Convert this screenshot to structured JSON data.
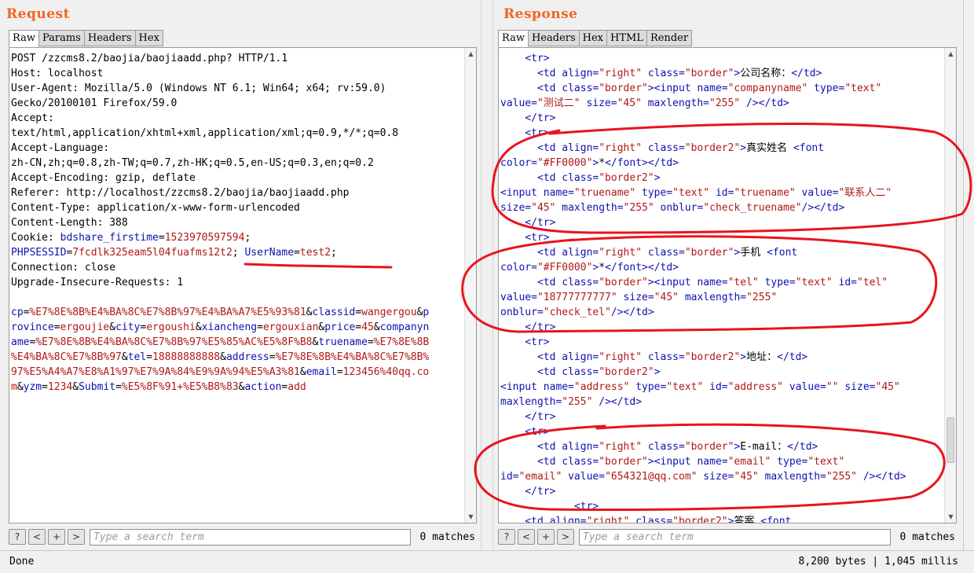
{
  "request": {
    "title": "Request",
    "tabs": [
      "Raw",
      "Params",
      "Headers",
      "Hex"
    ],
    "active_tab": "Raw",
    "lines": [
      [
        {
          "t": "POST /zzcms8.2/baojia/baojiaadd.php? HTTP/1.1",
          "c": "txt"
        }
      ],
      [
        {
          "t": "Host: localhost",
          "c": "txt"
        }
      ],
      [
        {
          "t": "User-Agent: Mozilla/5.0 (Windows NT 6.1; Win64; x64; rv:59.0)",
          "c": "txt"
        }
      ],
      [
        {
          "t": "Gecko/20100101 Firefox/59.0",
          "c": "txt"
        }
      ],
      [
        {
          "t": "Accept:",
          "c": "txt"
        }
      ],
      [
        {
          "t": "text/html,application/xhtml+xml,application/xml;q=0.9,*/*;q=0.8",
          "c": "txt"
        }
      ],
      [
        {
          "t": "Accept-Language:",
          "c": "txt"
        }
      ],
      [
        {
          "t": "zh-CN,zh;q=0.8,zh-TW;q=0.7,zh-HK;q=0.5,en-US;q=0.3,en;q=0.2",
          "c": "txt"
        }
      ],
      [
        {
          "t": "Accept-Encoding: gzip, deflate",
          "c": "txt"
        }
      ],
      [
        {
          "t": "Referer: http://localhost/zzcms8.2/baojia/baojiaadd.php",
          "c": "txt"
        }
      ],
      [
        {
          "t": "Content-Type: application/x-www-form-urlencoded",
          "c": "txt"
        }
      ],
      [
        {
          "t": "Content-Length: 388",
          "c": "txt"
        }
      ],
      [
        {
          "t": "Cookie: ",
          "c": "txt"
        },
        {
          "t": "bdshare_firstime",
          "c": "k"
        },
        {
          "t": "=",
          "c": "txt"
        },
        {
          "t": "1523970597594",
          "c": "v"
        },
        {
          "t": ";",
          "c": "txt"
        }
      ],
      [
        {
          "t": "PHPSESSID",
          "c": "k"
        },
        {
          "t": "=",
          "c": "txt"
        },
        {
          "t": "7fcdlk325eam5l04fuafms12t2",
          "c": "v"
        },
        {
          "t": "; ",
          "c": "txt"
        },
        {
          "t": "UserName",
          "c": "k"
        },
        {
          "t": "=",
          "c": "txt"
        },
        {
          "t": "test2",
          "c": "v"
        },
        {
          "t": ";",
          "c": "txt"
        }
      ],
      [
        {
          "t": "Connection: close",
          "c": "txt"
        }
      ],
      [
        {
          "t": "Upgrade-Insecure-Requests: 1",
          "c": "txt"
        }
      ],
      [
        {
          "t": "",
          "c": "txt"
        }
      ],
      [
        {
          "t": "cp",
          "c": "k"
        },
        {
          "t": "=",
          "c": "txt"
        },
        {
          "t": "%E7%8E%8B%E4%BA%8C%E7%8B%97%E4%BA%A7%E5%93%81",
          "c": "v"
        },
        {
          "t": "&",
          "c": "txt"
        },
        {
          "t": "classid",
          "c": "k"
        },
        {
          "t": "=",
          "c": "txt"
        },
        {
          "t": "wangergou",
          "c": "v"
        },
        {
          "t": "&",
          "c": "txt"
        },
        {
          "t": "p",
          "c": "k"
        }
      ],
      [
        {
          "t": "rovince",
          "c": "k"
        },
        {
          "t": "=",
          "c": "txt"
        },
        {
          "t": "ergoujie",
          "c": "v"
        },
        {
          "t": "&",
          "c": "txt"
        },
        {
          "t": "city",
          "c": "k"
        },
        {
          "t": "=",
          "c": "txt"
        },
        {
          "t": "ergoushi",
          "c": "v"
        },
        {
          "t": "&",
          "c": "txt"
        },
        {
          "t": "xiancheng",
          "c": "k"
        },
        {
          "t": "=",
          "c": "txt"
        },
        {
          "t": "ergouxian",
          "c": "v"
        },
        {
          "t": "&",
          "c": "txt"
        },
        {
          "t": "price",
          "c": "k"
        },
        {
          "t": "=",
          "c": "txt"
        },
        {
          "t": "45",
          "c": "v"
        },
        {
          "t": "&",
          "c": "txt"
        },
        {
          "t": "companyn",
          "c": "k"
        }
      ],
      [
        {
          "t": "ame",
          "c": "k"
        },
        {
          "t": "=",
          "c": "txt"
        },
        {
          "t": "%E7%8E%8B%E4%BA%8C%E7%8B%97%E5%85%AC%E5%8F%B8",
          "c": "v"
        },
        {
          "t": "&",
          "c": "txt"
        },
        {
          "t": "truename",
          "c": "k"
        },
        {
          "t": "=",
          "c": "txt"
        },
        {
          "t": "%E7%8E%8B",
          "c": "v"
        }
      ],
      [
        {
          "t": "%E4%BA%8C%E7%8B%97",
          "c": "v"
        },
        {
          "t": "&",
          "c": "txt"
        },
        {
          "t": "tel",
          "c": "k"
        },
        {
          "t": "=",
          "c": "txt"
        },
        {
          "t": "18888888888",
          "c": "v"
        },
        {
          "t": "&",
          "c": "txt"
        },
        {
          "t": "address",
          "c": "k"
        },
        {
          "t": "=",
          "c": "txt"
        },
        {
          "t": "%E7%8E%8B%E4%BA%8C%E7%8B%",
          "c": "v"
        }
      ],
      [
        {
          "t": "97%E5%A4%A7%E8%A1%97%E7%9A%84%E9%9A%94%E5%A3%81",
          "c": "v"
        },
        {
          "t": "&",
          "c": "txt"
        },
        {
          "t": "email",
          "c": "k"
        },
        {
          "t": "=",
          "c": "txt"
        },
        {
          "t": "123456%40qq.co",
          "c": "v"
        }
      ],
      [
        {
          "t": "m",
          "c": "v"
        },
        {
          "t": "&",
          "c": "txt"
        },
        {
          "t": "yzm",
          "c": "k"
        },
        {
          "t": "=",
          "c": "txt"
        },
        {
          "t": "1234",
          "c": "v"
        },
        {
          "t": "&",
          "c": "txt"
        },
        {
          "t": "Submit",
          "c": "k"
        },
        {
          "t": "=",
          "c": "txt"
        },
        {
          "t": "%E5%8F%91+%E5%B8%83",
          "c": "v"
        },
        {
          "t": "&",
          "c": "txt"
        },
        {
          "t": "action",
          "c": "k"
        },
        {
          "t": "=",
          "c": "txt"
        },
        {
          "t": "add",
          "c": "v"
        }
      ]
    ],
    "search_placeholder": "Type a search term",
    "matches": "0 matches"
  },
  "response": {
    "title": "Response",
    "tabs": [
      "Raw",
      "Headers",
      "Hex",
      "HTML",
      "Render"
    ],
    "active_tab": "Raw",
    "lines": [
      [
        {
          "t": "    <tr>",
          "c": "tag"
        }
      ],
      [
        {
          "t": "      <td align=",
          "c": "tag"
        },
        {
          "t": "\"right\"",
          "c": "str"
        },
        {
          "t": " class=",
          "c": "tag"
        },
        {
          "t": "\"border\"",
          "c": "str"
        },
        {
          "t": ">",
          "c": "tag"
        },
        {
          "t": "公司名称：",
          "c": "txt"
        },
        {
          "t": "</td>",
          "c": "tag"
        }
      ],
      [
        {
          "t": "      <td class=",
          "c": "tag"
        },
        {
          "t": "\"border\"",
          "c": "str"
        },
        {
          "t": "><input name=",
          "c": "tag"
        },
        {
          "t": "\"companyname\"",
          "c": "str"
        },
        {
          "t": " type=",
          "c": "tag"
        },
        {
          "t": "\"text\"",
          "c": "str"
        }
      ],
      [
        {
          "t": "value=",
          "c": "tag"
        },
        {
          "t": "\"测试二\"",
          "c": "str"
        },
        {
          "t": " size=",
          "c": "tag"
        },
        {
          "t": "\"45\"",
          "c": "str"
        },
        {
          "t": " maxlength=",
          "c": "tag"
        },
        {
          "t": "\"255\"",
          "c": "str"
        },
        {
          "t": " /></td>",
          "c": "tag"
        }
      ],
      [
        {
          "t": "    </tr>",
          "c": "tag"
        }
      ],
      [
        {
          "t": "    <tr>",
          "c": "tag"
        }
      ],
      [
        {
          "t": "      <td align=",
          "c": "tag"
        },
        {
          "t": "\"right\"",
          "c": "str"
        },
        {
          "t": " class=",
          "c": "tag"
        },
        {
          "t": "\"border2\"",
          "c": "str"
        },
        {
          "t": ">",
          "c": "tag"
        },
        {
          "t": "真实姓名 ",
          "c": "txt"
        },
        {
          "t": "<font",
          "c": "tag"
        }
      ],
      [
        {
          "t": "color=",
          "c": "tag"
        },
        {
          "t": "\"#FF0000\"",
          "c": "str"
        },
        {
          "t": ">",
          "c": "tag"
        },
        {
          "t": "*",
          "c": "txt"
        },
        {
          "t": "</font></td>",
          "c": "tag"
        }
      ],
      [
        {
          "t": "      <td class=",
          "c": "tag"
        },
        {
          "t": "\"border2\"",
          "c": "str"
        },
        {
          "t": ">",
          "c": "tag"
        }
      ],
      [
        {
          "t": "<input name=",
          "c": "tag"
        },
        {
          "t": "\"truename\"",
          "c": "str"
        },
        {
          "t": " type=",
          "c": "tag"
        },
        {
          "t": "\"text\"",
          "c": "str"
        },
        {
          "t": " id=",
          "c": "tag"
        },
        {
          "t": "\"truename\"",
          "c": "str"
        },
        {
          "t": " value=",
          "c": "tag"
        },
        {
          "t": "\"联系人二\"",
          "c": "str"
        }
      ],
      [
        {
          "t": "size=",
          "c": "tag"
        },
        {
          "t": "\"45\"",
          "c": "str"
        },
        {
          "t": " maxlength=",
          "c": "tag"
        },
        {
          "t": "\"255\"",
          "c": "str"
        },
        {
          "t": " onblur=",
          "c": "tag"
        },
        {
          "t": "\"check_truename\"",
          "c": "str"
        },
        {
          "t": "/></td>",
          "c": "tag"
        }
      ],
      [
        {
          "t": "    </tr>",
          "c": "tag"
        }
      ],
      [
        {
          "t": "    <tr>",
          "c": "tag"
        }
      ],
      [
        {
          "t": "      <td align=",
          "c": "tag"
        },
        {
          "t": "\"right\"",
          "c": "str"
        },
        {
          "t": " class=",
          "c": "tag"
        },
        {
          "t": "\"border\"",
          "c": "str"
        },
        {
          "t": ">",
          "c": "tag"
        },
        {
          "t": "手机 ",
          "c": "txt"
        },
        {
          "t": "<font",
          "c": "tag"
        }
      ],
      [
        {
          "t": "color=",
          "c": "tag"
        },
        {
          "t": "\"#FF0000\"",
          "c": "str"
        },
        {
          "t": ">",
          "c": "tag"
        },
        {
          "t": "*",
          "c": "txt"
        },
        {
          "t": "</font></td>",
          "c": "tag"
        }
      ],
      [
        {
          "t": "      <td class=",
          "c": "tag"
        },
        {
          "t": "\"border\"",
          "c": "str"
        },
        {
          "t": "><input name=",
          "c": "tag"
        },
        {
          "t": "\"tel\"",
          "c": "str"
        },
        {
          "t": " type=",
          "c": "tag"
        },
        {
          "t": "\"text\"",
          "c": "str"
        },
        {
          "t": " id=",
          "c": "tag"
        },
        {
          "t": "\"tel\"",
          "c": "str"
        }
      ],
      [
        {
          "t": "value=",
          "c": "tag"
        },
        {
          "t": "\"18777777777\"",
          "c": "str"
        },
        {
          "t": " size=",
          "c": "tag"
        },
        {
          "t": "\"45\"",
          "c": "str"
        },
        {
          "t": " maxlength=",
          "c": "tag"
        },
        {
          "t": "\"255\"",
          "c": "str"
        }
      ],
      [
        {
          "t": "onblur=",
          "c": "tag"
        },
        {
          "t": "\"check_tel\"",
          "c": "str"
        },
        {
          "t": "/></td>",
          "c": "tag"
        }
      ],
      [
        {
          "t": "    </tr>",
          "c": "tag"
        }
      ],
      [
        {
          "t": "    <tr>",
          "c": "tag"
        }
      ],
      [
        {
          "t": "      <td align=",
          "c": "tag"
        },
        {
          "t": "\"right\"",
          "c": "str"
        },
        {
          "t": " class=",
          "c": "tag"
        },
        {
          "t": "\"border2\"",
          "c": "str"
        },
        {
          "t": ">",
          "c": "tag"
        },
        {
          "t": "地址：",
          "c": "txt"
        },
        {
          "t": "</td>",
          "c": "tag"
        }
      ],
      [
        {
          "t": "      <td class=",
          "c": "tag"
        },
        {
          "t": "\"border2\"",
          "c": "str"
        },
        {
          "t": ">",
          "c": "tag"
        }
      ],
      [
        {
          "t": "<input name=",
          "c": "tag"
        },
        {
          "t": "\"address\"",
          "c": "str"
        },
        {
          "t": " type=",
          "c": "tag"
        },
        {
          "t": "\"text\"",
          "c": "str"
        },
        {
          "t": " id=",
          "c": "tag"
        },
        {
          "t": "\"address\"",
          "c": "str"
        },
        {
          "t": " value=",
          "c": "tag"
        },
        {
          "t": "\"\"",
          "c": "str"
        },
        {
          "t": " size=",
          "c": "tag"
        },
        {
          "t": "\"45\"",
          "c": "str"
        }
      ],
      [
        {
          "t": "maxlength=",
          "c": "tag"
        },
        {
          "t": "\"255\"",
          "c": "str"
        },
        {
          "t": " /></td>",
          "c": "tag"
        }
      ],
      [
        {
          "t": "    </tr>",
          "c": "tag"
        }
      ],
      [
        {
          "t": "    <tr>",
          "c": "tag"
        }
      ],
      [
        {
          "t": "      <td align=",
          "c": "tag"
        },
        {
          "t": "\"right\"",
          "c": "str"
        },
        {
          "t": " class=",
          "c": "tag"
        },
        {
          "t": "\"border\"",
          "c": "str"
        },
        {
          "t": ">",
          "c": "tag"
        },
        {
          "t": "E-mail：",
          "c": "txt"
        },
        {
          "t": "</td>",
          "c": "tag"
        }
      ],
      [
        {
          "t": "      <td class=",
          "c": "tag"
        },
        {
          "t": "\"border\"",
          "c": "str"
        },
        {
          "t": "><input name=",
          "c": "tag"
        },
        {
          "t": "\"email\"",
          "c": "str"
        },
        {
          "t": " type=",
          "c": "tag"
        },
        {
          "t": "\"text\"",
          "c": "str"
        }
      ],
      [
        {
          "t": "id=",
          "c": "tag"
        },
        {
          "t": "\"email\"",
          "c": "str"
        },
        {
          "t": " value=",
          "c": "tag"
        },
        {
          "t": "\"654321@qq.com\"",
          "c": "str"
        },
        {
          "t": " size=",
          "c": "tag"
        },
        {
          "t": "\"45\"",
          "c": "str"
        },
        {
          "t": " maxlength=",
          "c": "tag"
        },
        {
          "t": "\"255\"",
          "c": "str"
        },
        {
          "t": " /></td>",
          "c": "tag"
        }
      ],
      [
        {
          "t": "    </tr>",
          "c": "tag"
        }
      ],
      [
        {
          "t": "            <tr>",
          "c": "tag"
        }
      ],
      [
        {
          "t": "    <td align=",
          "c": "tag"
        },
        {
          "t": "\"right\"",
          "c": "str"
        },
        {
          "t": " class=",
          "c": "tag"
        },
        {
          "t": "\"border2\"",
          "c": "str"
        },
        {
          "t": ">",
          "c": "tag"
        },
        {
          "t": "答案 ",
          "c": "txt"
        },
        {
          "t": "<font",
          "c": "tag"
        }
      ]
    ],
    "search_placeholder": "Type a search term",
    "matches": "0 matches"
  },
  "search_buttons": [
    {
      "label": "?",
      "icon": "help-icon"
    },
    {
      "label": "<",
      "icon": "previous-icon"
    },
    {
      "label": "+",
      "icon": "plus-icon"
    },
    {
      "label": ">",
      "icon": "next-icon"
    }
  ],
  "status": {
    "left": "Done",
    "right": "8,200 bytes | 1,045 millis"
  },
  "colors": {
    "title": "#f26522",
    "key": "#1010b0",
    "value": "#b01818",
    "annotation": "#e8141e"
  }
}
